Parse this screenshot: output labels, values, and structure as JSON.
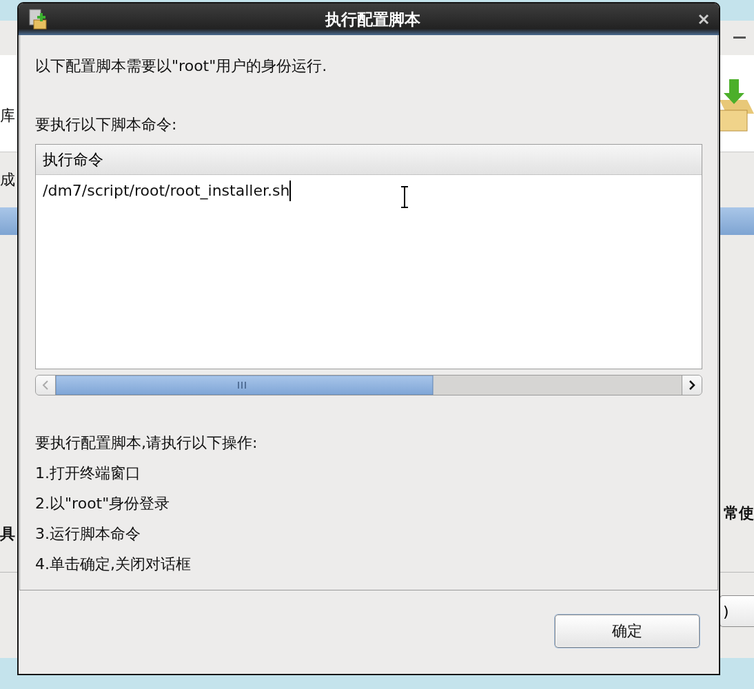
{
  "background_window": {
    "header_label": "库",
    "row_label": "成",
    "lower_left": "具",
    "lower_right": "常使",
    "button_label": ")"
  },
  "dialog": {
    "title": "执行配置脚本",
    "intro": "以下配置脚本需要以\"root\"用户的身份运行.",
    "commands_label": "要执行以下脚本命令:",
    "table": {
      "columns": [
        "执行命令"
      ],
      "rows": [
        "/dm7/script/root/root_installer.sh"
      ]
    },
    "instructions_title": "要执行配置脚本,请执行以下操作:",
    "instructions": [
      "1.打开终端窗口",
      "2.以\"root\"身份登录",
      "3.运行脚本命令",
      "4.单击确定,关闭对话框"
    ],
    "buttons": [
      "确定"
    ]
  }
}
